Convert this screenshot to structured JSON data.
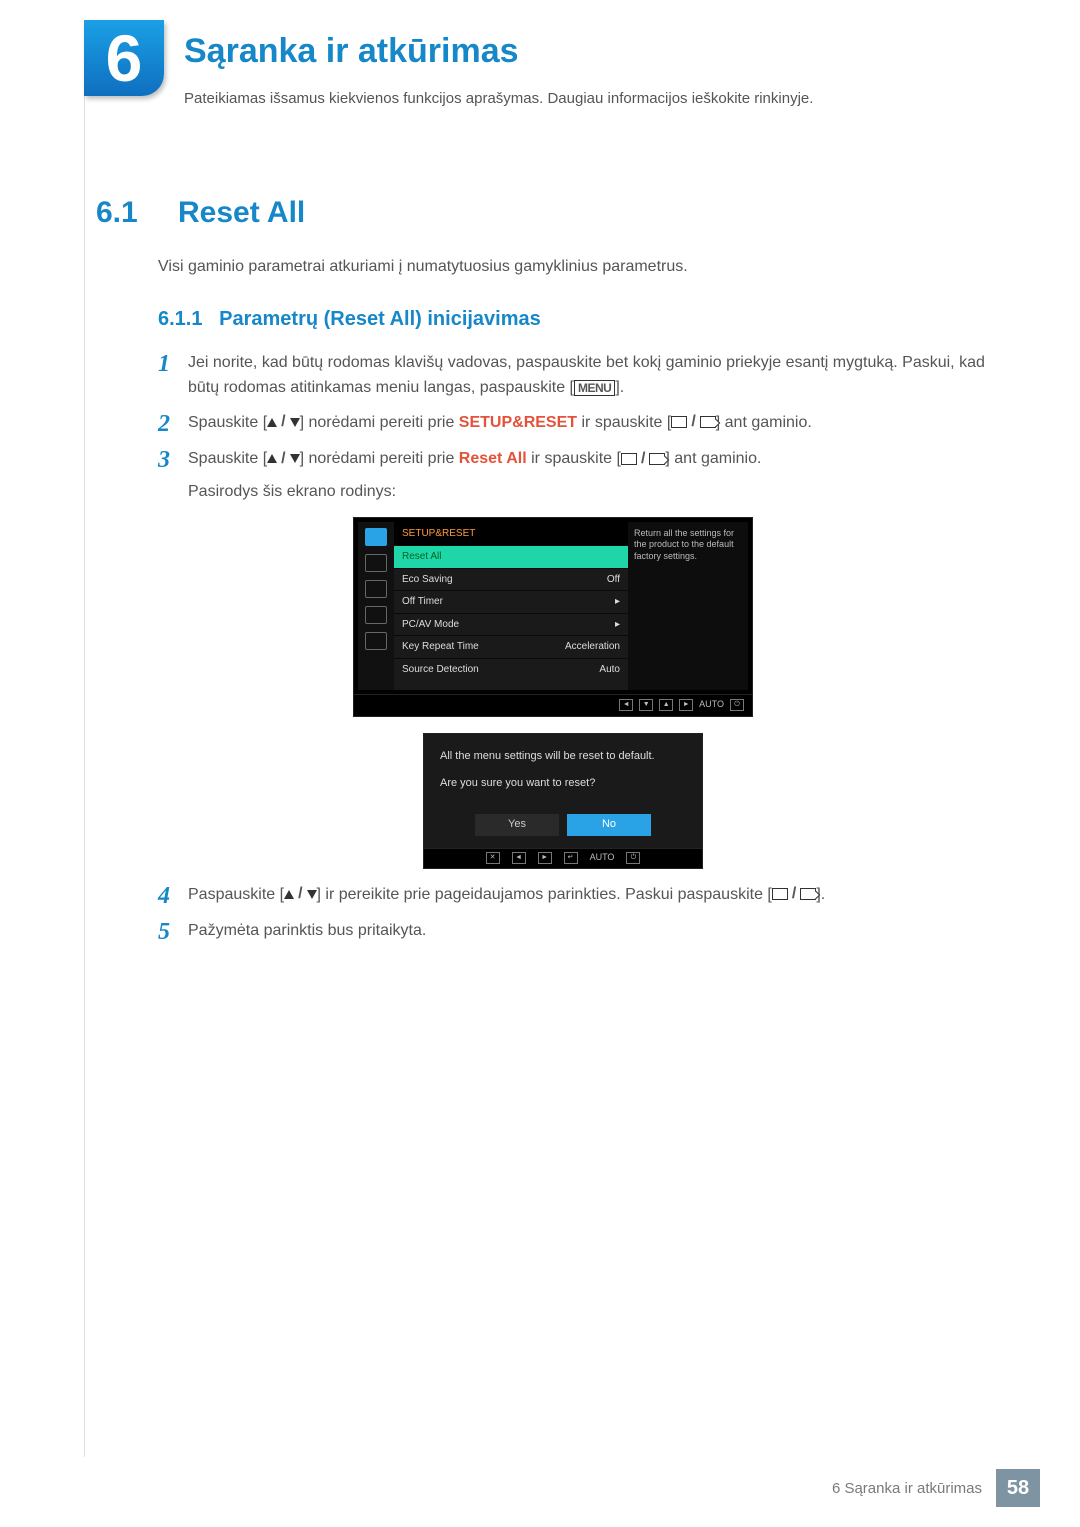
{
  "chapter": {
    "num": "6",
    "title": "Sąranka ir atkūrimas",
    "desc": "Pateikiamas išsamus kiekvienos funkcijos aprašymas. Daugiau informacijos ieškokite rinkinyje."
  },
  "section": {
    "num": "6.1",
    "title": "Reset All",
    "body": "Visi gaminio parametrai atkuriami į numatytuosius gamyklinius parametrus."
  },
  "subsection": {
    "num": "6.1.1",
    "title": "Parametrų (Reset All) inicijavimas"
  },
  "steps": {
    "s1a": "Jei norite, kad būtų rodomas klavišų vadovas, paspauskite bet kokį gaminio priekyje esantį mygtuką. Paskui, kad būtų rodomas atitinkamas meniu langas, paspauskite [",
    "s1b": "].",
    "s2a": "Spauskite [",
    "s2b": "] norėdami pereiti prie ",
    "s2c": "SETUP&RESET",
    "s2d": " ir spauskite [",
    "s2e": "] ant gaminio.",
    "s3a": "Spauskite [",
    "s3b": "] norėdami pereiti prie ",
    "s3c": "Reset All",
    "s3d": " ir spauskite [",
    "s3e": "] ant gaminio.",
    "s3f": "Pasirodys šis ekrano rodinys:",
    "s4a": "Paspauskite [",
    "s4b": "] ir pereikite prie pageidaujamos parinkties. Paskui paspauskite [",
    "s4c": "].",
    "s5": "Pažymėta parinktis bus pritaikyta.",
    "menu": "MENU"
  },
  "osd": {
    "head": "SETUP&RESET",
    "rows": [
      {
        "l": "Reset All",
        "r": ""
      },
      {
        "l": "Eco Saving",
        "r": "Off"
      },
      {
        "l": "Off Timer",
        "r": "▸"
      },
      {
        "l": "PC/AV Mode",
        "r": "▸"
      },
      {
        "l": "Key Repeat Time",
        "r": "Acceleration"
      },
      {
        "l": "Source Detection",
        "r": "Auto"
      }
    ],
    "help": "Return all the settings for the product to the default factory settings.",
    "auto": "AUTO"
  },
  "confirm": {
    "line1": "All the menu settings will be reset to default.",
    "line2": "Are you sure you want to reset?",
    "yes": "Yes",
    "no": "No",
    "auto": "AUTO"
  },
  "footer": {
    "label": "6 Sąranka ir atkūrimas",
    "page": "58"
  }
}
